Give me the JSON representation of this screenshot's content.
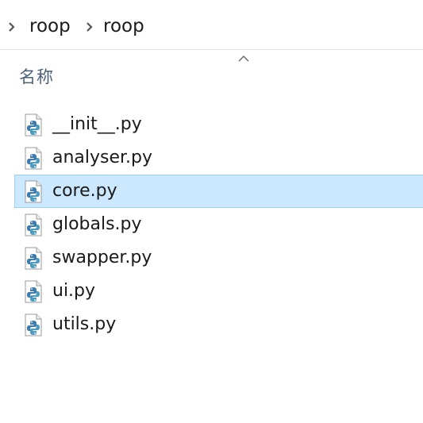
{
  "breadcrumb": {
    "items": [
      {
        "label": "roop"
      },
      {
        "label": "roop"
      }
    ]
  },
  "column_header": {
    "name_label": "名称",
    "sort_direction": "ascending"
  },
  "files": [
    {
      "name": "__init__.py",
      "icon": "python-file-icon",
      "selected": false
    },
    {
      "name": "analyser.py",
      "icon": "python-file-icon",
      "selected": false
    },
    {
      "name": "core.py",
      "icon": "python-file-icon",
      "selected": true
    },
    {
      "name": "globals.py",
      "icon": "python-file-icon",
      "selected": false
    },
    {
      "name": "swapper.py",
      "icon": "python-file-icon",
      "selected": false
    },
    {
      "name": "ui.py",
      "icon": "python-file-icon",
      "selected": false
    },
    {
      "name": "utils.py",
      "icon": "python-file-icon",
      "selected": false
    }
  ],
  "colors": {
    "selection_fill": "#cce8ff",
    "selection_border": "#99d1ff",
    "python_blue": "#3f7cae",
    "python_teal": "#4d9bbf"
  }
}
